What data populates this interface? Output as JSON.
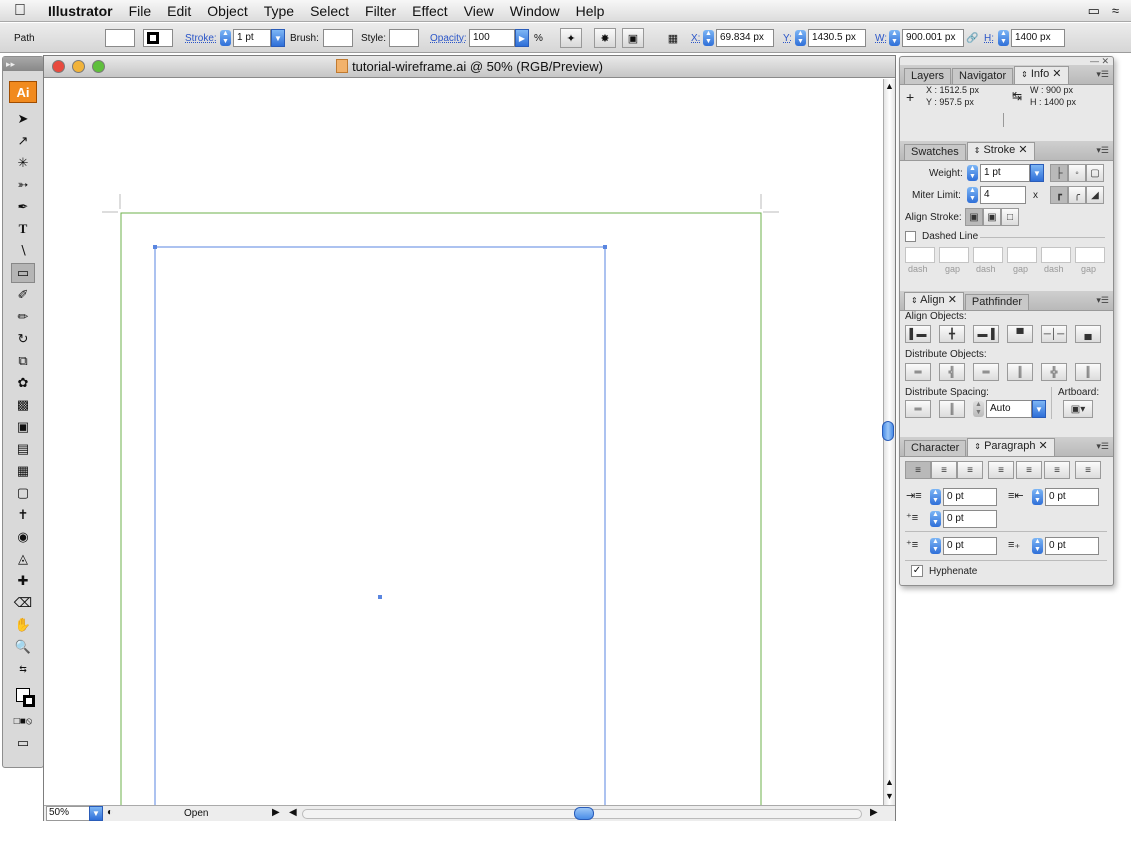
{
  "menubar": {
    "apple": "",
    "app": "Illustrator",
    "items": [
      "File",
      "Edit",
      "Object",
      "Type",
      "Select",
      "Filter",
      "Effect",
      "View",
      "Window",
      "Help"
    ]
  },
  "controlbar": {
    "selection": "Path",
    "stroke_label": "Stroke:",
    "stroke_value": "1 pt",
    "brush_label": "Brush:",
    "style_label": "Style:",
    "opacity_label": "Opacity:",
    "opacity_value": "100",
    "percent": "%",
    "x_label": "X:",
    "x_value": "69.834 px",
    "y_label": "Y:",
    "y_value": "1430.5 px",
    "w_label": "W:",
    "w_value": "900.001 px",
    "h_label": "H:",
    "h_value": "1400 px"
  },
  "tools": {
    "logo": "Ai"
  },
  "document": {
    "title": "tutorial-wireframe.ai @ 50% (RGB/Preview)",
    "zoom": "50%",
    "status": "Open"
  },
  "info_panel": {
    "tabs": [
      "Layers",
      "Navigator",
      "Info"
    ],
    "x": "X :   1512.5 px",
    "y": "Y :   957.5 px",
    "w": "W :   900 px",
    "h": "H :   1400 px"
  },
  "stroke_panel": {
    "tabs": [
      "Swatches",
      "Stroke"
    ],
    "weight_label": "Weight:",
    "weight_value": "1 pt",
    "miter_label": "Miter Limit:",
    "miter_value": "4",
    "miter_unit": "x",
    "align_label": "Align Stroke:",
    "dashed_label": "Dashed Line",
    "dash_labels": [
      "dash",
      "gap",
      "dash",
      "gap",
      "dash",
      "gap"
    ]
  },
  "align_panel": {
    "tabs": [
      "Align",
      "Pathfinder"
    ],
    "align_objects": "Align Objects:",
    "distribute_objects": "Distribute Objects:",
    "distribute_spacing": "Distribute Spacing:",
    "artboard": "Artboard:",
    "spacing_value": "Auto"
  },
  "paragraph_panel": {
    "tabs": [
      "Character",
      "Paragraph"
    ],
    "left_indent": "0 pt",
    "right_indent": "0 pt",
    "first_indent": "0 pt",
    "space_before": "0 pt",
    "space_after": "0 pt",
    "hyphenate": "Hyphenate"
  }
}
